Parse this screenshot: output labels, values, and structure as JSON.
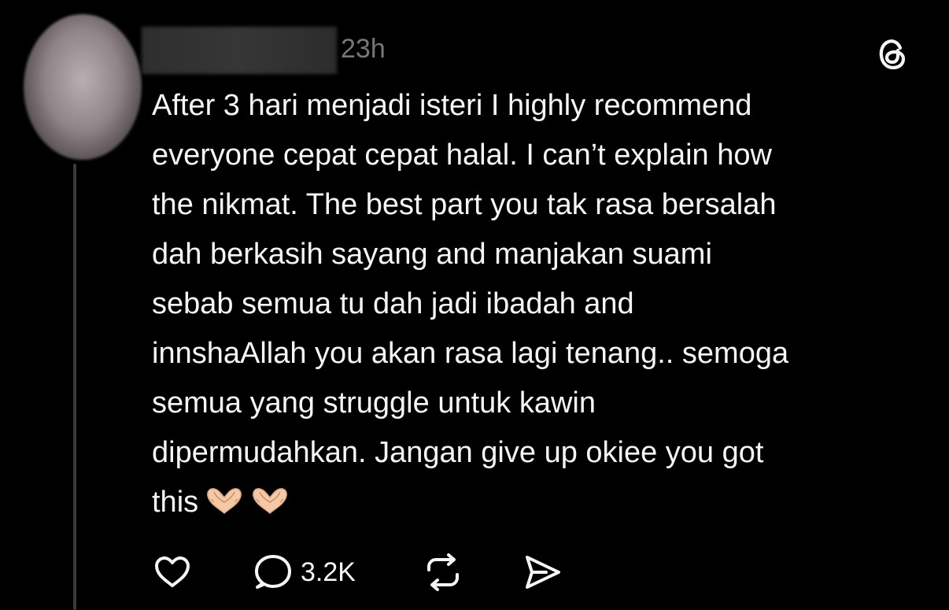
{
  "post": {
    "timestamp": "23h",
    "text": "After 3 hari menjadi isteri I highly recommend\neveryone cepat cepat halal. I can’t explain how\nthe nikmat. The best part you tak rasa bersalah\ndah berkasih sayang and manjakan suami\nsebab semua tu dah jadi ibadah and\ninnshaAllah you akan rasa lagi tenang.. semoga\nsemua yang struggle untuk kawin\ndipermudahkan. Jangan give up okiee you got\nthis",
    "emojis": [
      "heart-hands-emoji",
      "heart-hands-emoji"
    ]
  },
  "actions": {
    "like_icon": "heart-icon",
    "reply_icon": "comment-bubble-icon",
    "reply_count": "3.2K",
    "repost_icon": "repost-icon",
    "share_icon": "send-icon"
  },
  "header": {
    "logo_icon": "threads-logo-icon"
  },
  "colors": {
    "background": "#000000",
    "text": "#f3f5f7",
    "muted": "#777777",
    "thread_line": "#3a3a3a"
  }
}
